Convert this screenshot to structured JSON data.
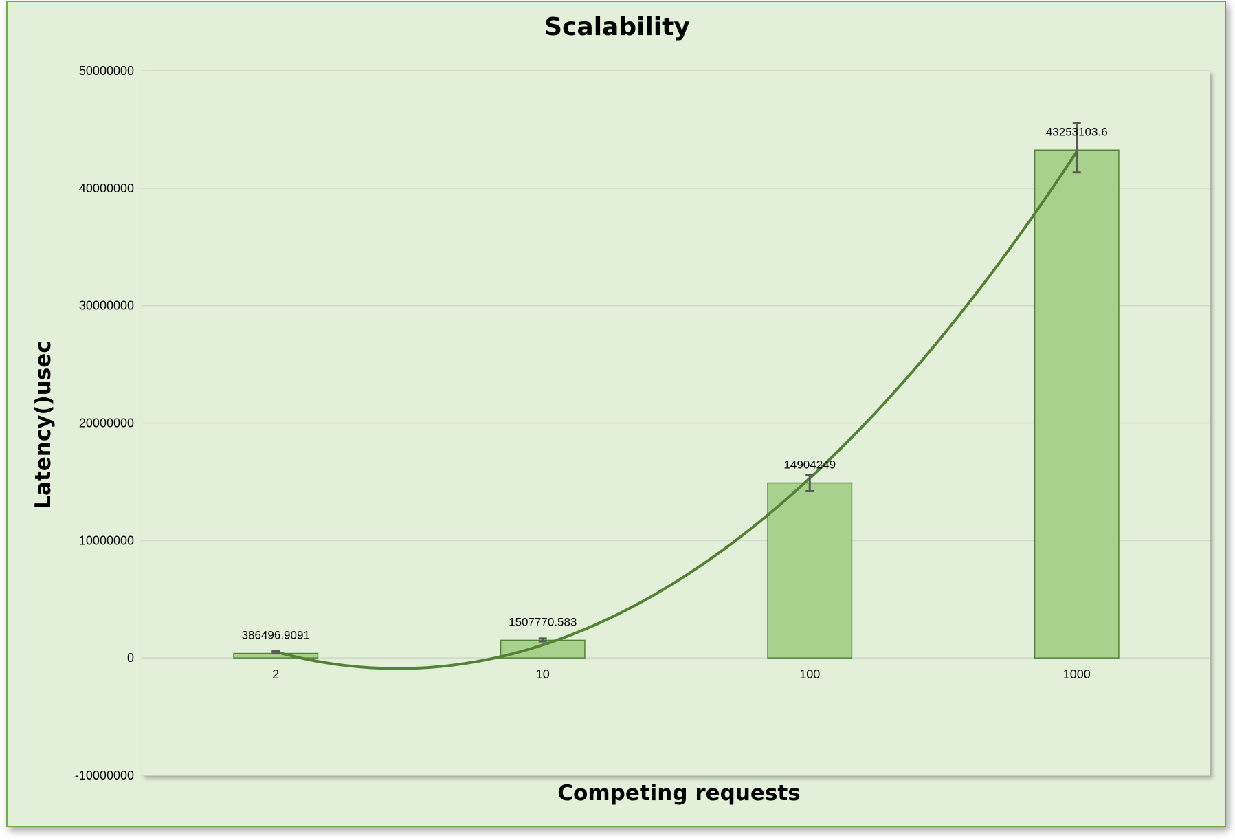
{
  "chart_data": {
    "type": "bar",
    "title": "Scalability",
    "xlabel": "Competing requests",
    "ylabel": "Latency()usec",
    "categories": [
      "2",
      "10",
      "100",
      "1000"
    ],
    "values": [
      386496.9091,
      1507770.583,
      14904249,
      43253103.6
    ],
    "data_labels": [
      "386496.9091",
      "1507770.583",
      "14904249",
      "43253103.6"
    ],
    "error_bars": [
      [
        0,
        200000
      ],
      [
        100000,
        150000
      ],
      [
        700000,
        700000
      ],
      [
        1900000,
        2300000
      ]
    ],
    "trendline": {
      "type": "polynomial",
      "order": 2
    },
    "ylim": [
      -10000000,
      50000000
    ],
    "yticks": [
      -10000000,
      0,
      10000000,
      20000000,
      30000000,
      40000000,
      50000000
    ],
    "ytick_labels": [
      "-10000000",
      "0",
      "10000000",
      "20000000",
      "30000000",
      "40000000",
      "50000000"
    ],
    "grid": true,
    "legend": "none",
    "colors": {
      "bar_fill": "#a9d18e",
      "bar_edge": "#548235",
      "trendline": "#548235",
      "error_bar": "#595959",
      "plot_background": "#e2efd9",
      "gridline": "#d0d7cc"
    }
  }
}
